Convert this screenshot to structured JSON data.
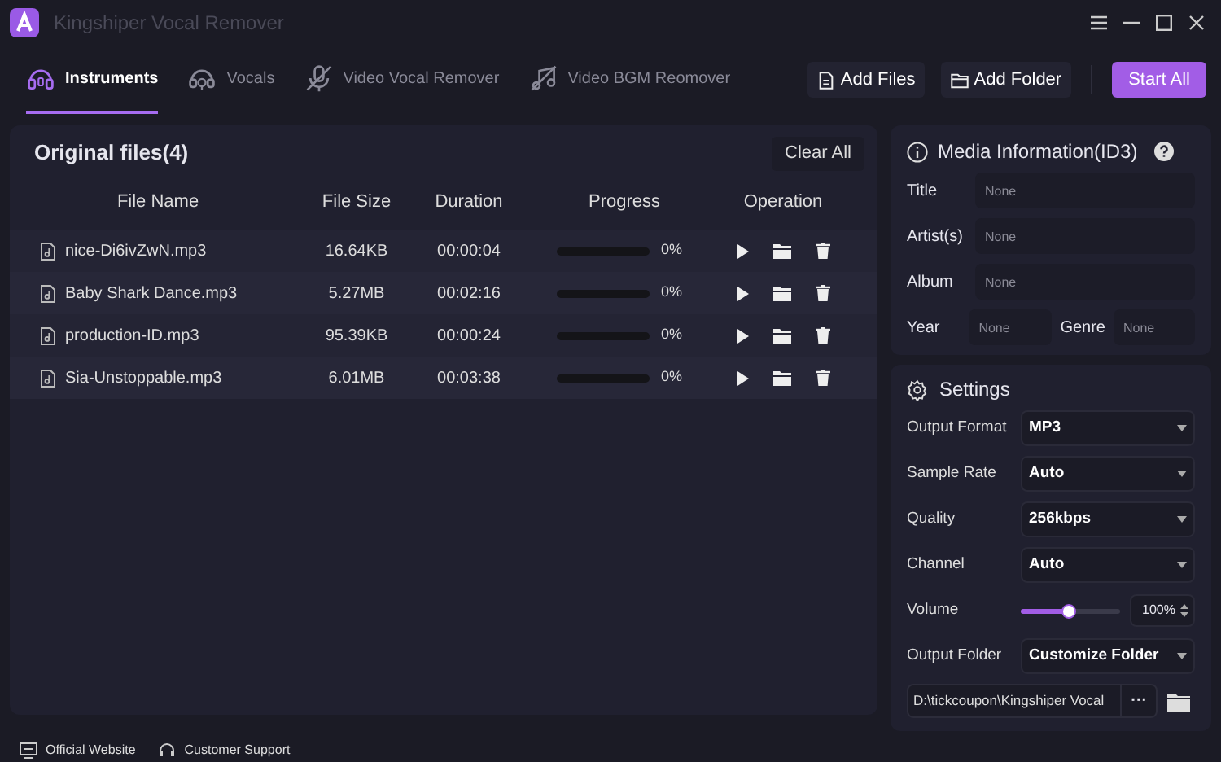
{
  "window": {
    "title": "Kingshiper Vocal Remover"
  },
  "tabs": [
    {
      "label": "Instruments",
      "selected": true,
      "kind": "headphones"
    },
    {
      "label": "Vocals",
      "selected": false,
      "kind": "vocals"
    },
    {
      "label": "Video Vocal Remover",
      "selected": false,
      "kind": "mic-off"
    },
    {
      "label": "Video BGM Reomover",
      "selected": false,
      "kind": "music-off"
    }
  ],
  "toolbar": [
    {
      "label": "Add Files",
      "kind": "file"
    },
    {
      "label": "Add Folder",
      "kind": "folder"
    },
    {
      "label": "Start All",
      "kind": "primary"
    }
  ],
  "files": {
    "title": "Original files(4)",
    "clear": "Clear All",
    "columns": [
      "File Name",
      "File Size",
      "Duration",
      "Progress",
      "Operation"
    ],
    "rows": [
      {
        "name": "nice-Di6ivZwN.mp3",
        "size": "16.64KB",
        "duration": "00:00:04",
        "level": 0,
        "progress": "0%"
      },
      {
        "name": "Baby Shark Dance.mp3",
        "size": "5.27MB",
        "duration": "00:02:16",
        "level": 0,
        "progress": "0%"
      },
      {
        "name": "production-ID.mp3",
        "size": "95.39KB",
        "duration": "00:00:24",
        "level": 0,
        "progress": "0%"
      },
      {
        "name": "Sia-Unstoppable.mp3",
        "size": "6.01MB",
        "duration": "00:03:38",
        "level": 0,
        "progress": "0%"
      }
    ]
  },
  "media": {
    "title": "Media Information(ID3)",
    "fields": [
      {
        "label": "Title",
        "placeholder": "None"
      },
      {
        "label": "Artist(s)",
        "placeholder": "None"
      },
      {
        "label": "Album",
        "placeholder": "None"
      },
      {
        "label": "Year",
        "placeholder": "None"
      },
      {
        "label": "Genre",
        "placeholder": "None"
      }
    ]
  },
  "settings": {
    "title": "Settings",
    "rows": [
      {
        "kind": "select",
        "label": "Output Format",
        "value": "MP3"
      },
      {
        "kind": "select",
        "label": "Sample Rate",
        "value": "Auto"
      },
      {
        "kind": "select",
        "label": "Quality",
        "value": "256kbps"
      },
      {
        "kind": "select",
        "label": "Channel",
        "value": "Auto"
      },
      {
        "kind": "slider",
        "label": "Volume",
        "level": 0.48,
        "reading": "100%"
      },
      {
        "kind": "select",
        "label": "Output Folder",
        "value": "Customize Folder"
      }
    ],
    "path": "D:\\tickcoupon\\Kingshiper Vocal",
    "browse": "···"
  },
  "footer": [
    {
      "label": "Official Website",
      "kind": "monitor"
    },
    {
      "label": "Customer Support",
      "kind": "headset"
    }
  ]
}
